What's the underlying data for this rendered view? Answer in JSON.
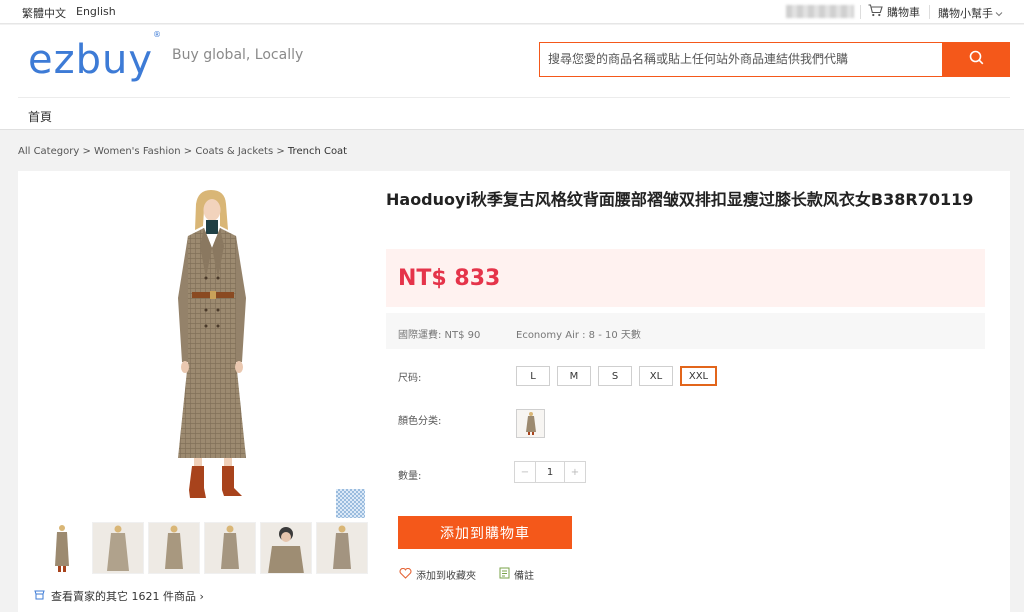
{
  "topbar": {
    "lang_trad": "繁體中文",
    "lang_en": "English",
    "cart": "購物車",
    "helper": "購物小幫手"
  },
  "header": {
    "logo": "ezbuy",
    "slogan": "Buy global, Locally",
    "search_placeholder": "搜尋您愛的商品名稱或貼上任何站外商品連結供我們代購",
    "nav_home": "首頁"
  },
  "breadcrumb": {
    "items": [
      "All Category",
      "Women's Fashion",
      "Coats & Jackets"
    ],
    "separator": ">",
    "current": "Trench Coat"
  },
  "product": {
    "title": "Haoduoyi秋季复古风格纹背面腰部褶皱双排扣显瘦过膝长款风衣女B38R70119",
    "price": "NT$ 833",
    "shipping_fee": "國際運費: NT$ 90",
    "shipping_time": "Economy Air : 8 - 10 天數",
    "size_label": "尺码:",
    "sizes": [
      "L",
      "M",
      "S",
      "XL",
      "XXL"
    ],
    "selected_size": "XXL",
    "color_label": "顏色分类:",
    "qty_label": "數量:",
    "qty_minus": "−",
    "qty_value": "1",
    "qty_plus": "+",
    "add_to_cart": "添加到購物車",
    "add_to_fav": "添加到收藏夾",
    "note": "備註",
    "more_prefix": "查看賣家的其它",
    "more_count": "1621",
    "more_suffix": "件商品",
    "more_arrow": "›"
  },
  "colors": {
    "accent": "#f4581a",
    "price": "#e5344a",
    "logo": "#3d7bd6"
  }
}
